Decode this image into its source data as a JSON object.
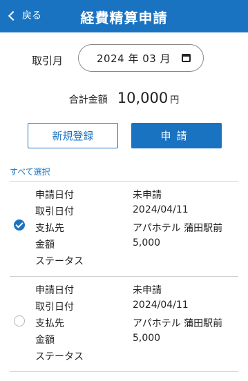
{
  "header": {
    "back_label": "戻る",
    "title": "経費精算申請"
  },
  "month": {
    "label": "取引月",
    "value": "2024 年 03 月"
  },
  "total": {
    "label": "合計金額",
    "amount": "10,000",
    "unit": "円"
  },
  "buttons": {
    "new_label": "新規登録",
    "apply_label": "申請"
  },
  "select_all_label": "すべて選択",
  "field_labels": [
    "申請日付",
    "取引日付",
    "支払先",
    "金額",
    "ステータス"
  ],
  "items": [
    {
      "selected": true,
      "values": [
        "未申請",
        "2024/04/11",
        "アパホテル 蒲田駅前",
        "5,000",
        ""
      ]
    },
    {
      "selected": false,
      "values": [
        "未申請",
        "2024/04/11",
        "アパホテル 蒲田駅前",
        "5,000",
        ""
      ]
    }
  ]
}
